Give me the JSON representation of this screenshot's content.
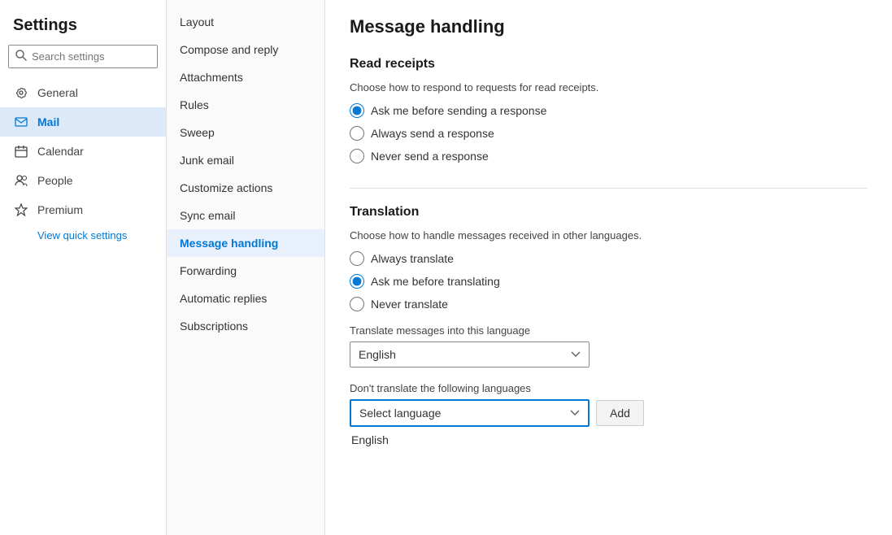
{
  "sidebar": {
    "title": "Settings",
    "search_placeholder": "Search settings",
    "nav_items": [
      {
        "id": "general",
        "label": "General",
        "icon": "gear"
      },
      {
        "id": "mail",
        "label": "Mail",
        "icon": "mail",
        "active": true
      },
      {
        "id": "calendar",
        "label": "Calendar",
        "icon": "calendar"
      },
      {
        "id": "people",
        "label": "People",
        "icon": "people"
      },
      {
        "id": "premium",
        "label": "Premium",
        "icon": "premium"
      }
    ],
    "quick_settings_label": "View quick settings"
  },
  "mid_nav": {
    "items": [
      {
        "id": "layout",
        "label": "Layout"
      },
      {
        "id": "compose-reply",
        "label": "Compose and reply"
      },
      {
        "id": "attachments",
        "label": "Attachments"
      },
      {
        "id": "rules",
        "label": "Rules"
      },
      {
        "id": "sweep",
        "label": "Sweep"
      },
      {
        "id": "junk-email",
        "label": "Junk email"
      },
      {
        "id": "customize-actions",
        "label": "Customize actions"
      },
      {
        "id": "sync-email",
        "label": "Sync email"
      },
      {
        "id": "message-handling",
        "label": "Message handling",
        "active": true
      },
      {
        "id": "forwarding",
        "label": "Forwarding"
      },
      {
        "id": "automatic-replies",
        "label": "Automatic replies"
      },
      {
        "id": "subscriptions",
        "label": "Subscriptions"
      }
    ]
  },
  "main": {
    "page_title": "Message handling",
    "read_receipts": {
      "section_title": "Read receipts",
      "subtitle": "Choose how to respond to requests for read receipts.",
      "options": [
        {
          "id": "ask",
          "label": "Ask me before sending a response",
          "checked": true
        },
        {
          "id": "always",
          "label": "Always send a response",
          "checked": false
        },
        {
          "id": "never",
          "label": "Never send a response",
          "checked": false
        }
      ]
    },
    "translation": {
      "section_title": "Translation",
      "subtitle": "Choose how to handle messages received in other languages.",
      "options": [
        {
          "id": "always-translate",
          "label": "Always translate",
          "checked": false
        },
        {
          "id": "ask-translate",
          "label": "Ask me before translating",
          "checked": true
        },
        {
          "id": "never-translate",
          "label": "Never translate",
          "checked": false
        }
      ],
      "language_field_label": "Translate messages into this language",
      "language_selected": "English",
      "dont_translate_label": "Don't translate the following languages",
      "select_language_placeholder": "Select language",
      "add_button_label": "Add",
      "added_language": "English"
    }
  }
}
